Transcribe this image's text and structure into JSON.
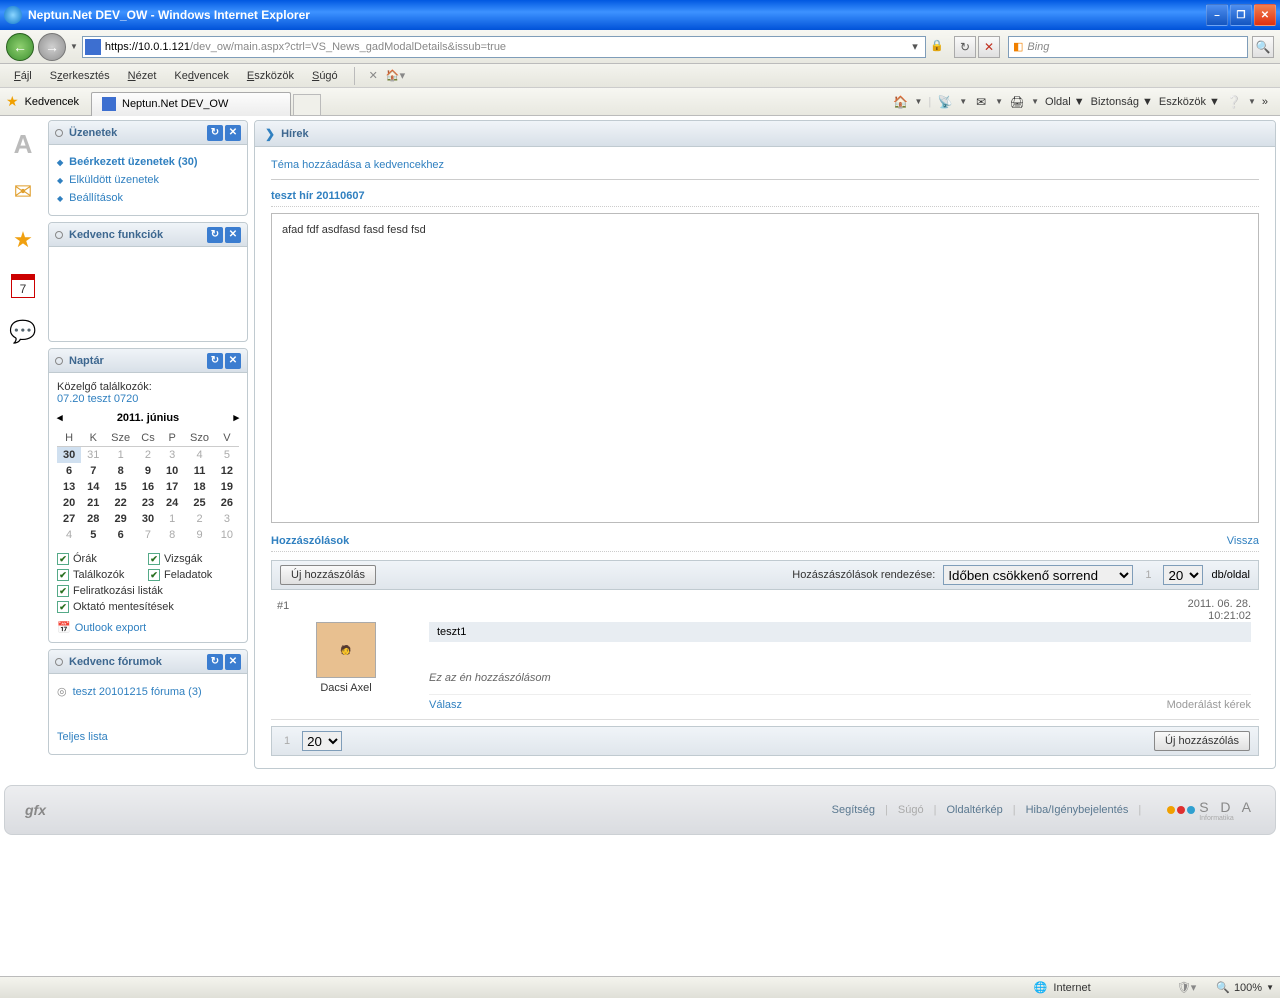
{
  "window": {
    "title": "Neptun.Net DEV_OW - Windows Internet Explorer",
    "url_domain": "https://10.0.1.121",
    "url_path": "/dev_ow/main.aspx?ctrl=VS_News_gadModalDetails&issub=true"
  },
  "search_placeholder": "Bing",
  "menu": [
    "Fájl",
    "Szerkesztés",
    "Nézet",
    "Kedvencek",
    "Eszközök",
    "Súgó"
  ],
  "fav_label": "Kedvencek",
  "tab_title": "Neptun.Net DEV_OW",
  "cmdbar": {
    "page": "Oldal",
    "safety": "Biztonság",
    "tools": "Eszközök"
  },
  "widgets": {
    "messages": {
      "title": "Üzenetek",
      "items": [
        "Beérkezett üzenetek (30)",
        "Elküldött üzenetek",
        "Beállítások"
      ]
    },
    "favfn": {
      "title": "Kedvenc funkciók"
    },
    "calendar": {
      "title": "Naptár",
      "upcoming_label": "Közelgő találkozók:",
      "upcoming_item": "07.20 teszt 0720",
      "month": "2011. június",
      "days": [
        "H",
        "K",
        "Sze",
        "Cs",
        "P",
        "Szo",
        "V"
      ],
      "weeks": [
        [
          "30",
          "31",
          "1",
          "2",
          "3",
          "4",
          "5"
        ],
        [
          "6",
          "7",
          "8",
          "9",
          "10",
          "11",
          "12"
        ],
        [
          "13",
          "14",
          "15",
          "16",
          "17",
          "18",
          "19"
        ],
        [
          "20",
          "21",
          "22",
          "23",
          "24",
          "25",
          "26"
        ],
        [
          "27",
          "28",
          "29",
          "30",
          "1",
          "2",
          "3"
        ],
        [
          "4",
          "5",
          "6",
          "7",
          "8",
          "9",
          "10"
        ]
      ],
      "checks": [
        "Órák",
        "Vizsgák",
        "Találkozók",
        "Feladatok",
        "Feliratkozási listák",
        "Oktató mentesítések"
      ],
      "outlook": "Outlook export"
    },
    "forums": {
      "title": "Kedvenc fórumok",
      "item": "teszt 20101215 fóruma (3)",
      "full": "Teljes lista"
    }
  },
  "main": {
    "title": "Hírek",
    "add_fav": "Téma hozzáadása a kedvencekhez",
    "news_title": "teszt hír 20110607",
    "news_body": "afad fdf asdfasd fasd fesd fsd",
    "comments_title": "Hozzászólások",
    "back": "Vissza",
    "new_comment": "Új hozzászólás",
    "sort_label": "Hozászászólások rendezése:",
    "sort_value": "Időben csökkenő sorrend",
    "per_page_label": "db/oldal",
    "per_page_value": "20",
    "comment": {
      "idx": "#1",
      "date": "2011. 06. 28.",
      "time": "10:21:02",
      "subject": "teszt1",
      "text": "Ez az én hozzászólásom",
      "author": "Dacsi Axel",
      "reply": "Válasz",
      "moderate": "Moderálást kérek"
    }
  },
  "footer": {
    "links": [
      "Segítség",
      "Súgó",
      "Oldaltérkép",
      "Hiba/Igénybejelentés"
    ],
    "brand": "S D A",
    "brand_sub": "Informatika"
  },
  "status": {
    "zone": "Internet",
    "zoom": "100%"
  }
}
